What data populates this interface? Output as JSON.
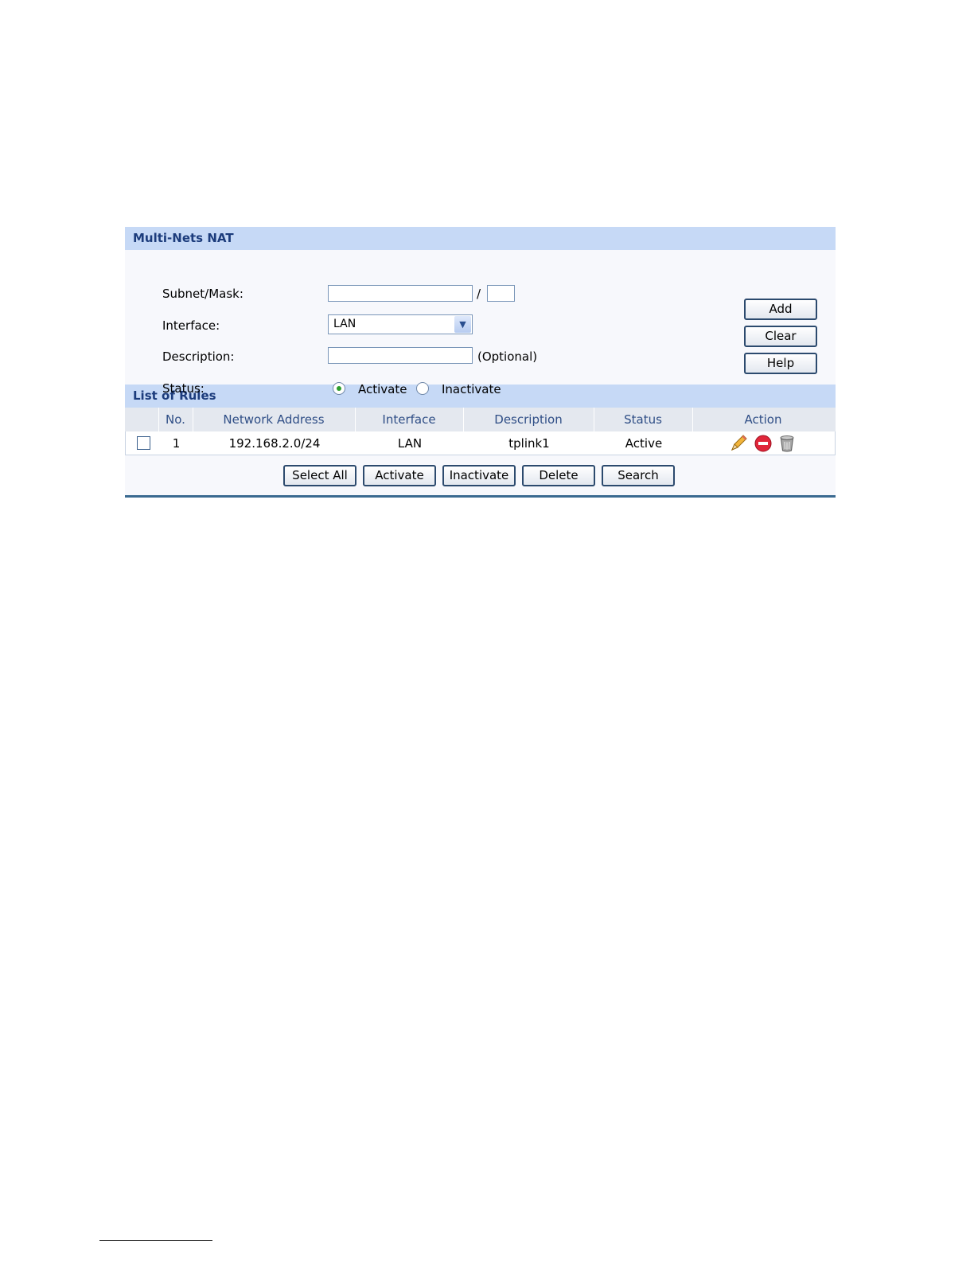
{
  "form": {
    "title": "Multi-Nets NAT",
    "subnet_label": "Subnet/Mask:",
    "subnet_value": "",
    "mask_separator": "/",
    "mask_value": "",
    "interface_label": "Interface:",
    "interface_value": "LAN",
    "description_label": "Description:",
    "description_value": "",
    "description_hint": "(Optional)",
    "status_label": "Status:",
    "status_options": [
      "Activate",
      "Inactivate"
    ],
    "status_selected": "Activate",
    "buttons": {
      "add": "Add",
      "clear": "Clear",
      "help": "Help"
    }
  },
  "rules": {
    "title": "List of Rules",
    "columns": [
      "No.",
      "Network Address",
      "Interface",
      "Description",
      "Status",
      "Action"
    ],
    "rows": [
      {
        "no": "1",
        "network_address": "192.168.2.0/24",
        "interface": "LAN",
        "description": "tplink1",
        "status": "Active",
        "checked": false,
        "actions": [
          "edit-icon",
          "disable-icon",
          "delete-icon"
        ]
      }
    ],
    "buttons": {
      "select_all": "Select All",
      "activate": "Activate",
      "inactivate": "Inactivate",
      "delete": "Delete",
      "search": "Search"
    }
  }
}
